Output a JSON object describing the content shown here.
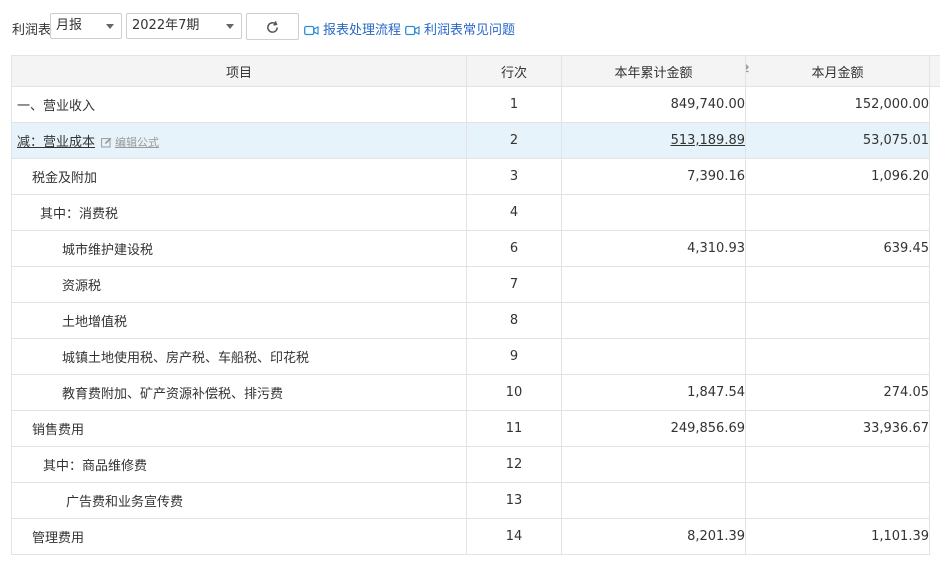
{
  "toolbar": {
    "report_label": "利润表",
    "period_type": "月报",
    "period": "2022年7期",
    "links": {
      "process": "报表处理流程",
      "faq": "利润表常见问题"
    }
  },
  "table": {
    "headers": {
      "item": "项目",
      "row": "行次",
      "ytd": "本年累计金额",
      "swap_icon": "⇄",
      "month": "本月金额"
    },
    "edit_formula": "编辑公式",
    "rows": [
      {
        "name": "一、营业收入",
        "row": "1",
        "ytd": "849,740.00",
        "month": "152,000.00"
      },
      {
        "name": "减：营业成本",
        "row": "2",
        "ytd": "513,189.89",
        "month": "53,075.01"
      },
      {
        "name": "税金及附加",
        "row": "3",
        "ytd": "7,390.16",
        "month": "1,096.20"
      },
      {
        "name": "其中：消费税",
        "row": "4",
        "ytd": "",
        "month": ""
      },
      {
        "name": "城市维护建设税",
        "row": "6",
        "ytd": "4,310.93",
        "month": "639.45"
      },
      {
        "name": "资源税",
        "row": "7",
        "ytd": "",
        "month": ""
      },
      {
        "name": "土地增值税",
        "row": "8",
        "ytd": "",
        "month": ""
      },
      {
        "name": "城镇土地使用税、房产税、车船税、印花税",
        "row": "9",
        "ytd": "",
        "month": ""
      },
      {
        "name": "教育费附加、矿产资源补偿税、排污费",
        "row": "10",
        "ytd": "1,847.54",
        "month": "274.05"
      },
      {
        "name": "销售费用",
        "row": "11",
        "ytd": "249,856.69",
        "month": "33,936.67"
      },
      {
        "name": "其中：商品维修费",
        "row": "12",
        "ytd": "",
        "month": ""
      },
      {
        "name": "广告费和业务宣传费",
        "row": "13",
        "ytd": "",
        "month": ""
      },
      {
        "name": "管理费用",
        "row": "14",
        "ytd": "8,201.39",
        "month": "1,101.39"
      }
    ]
  }
}
